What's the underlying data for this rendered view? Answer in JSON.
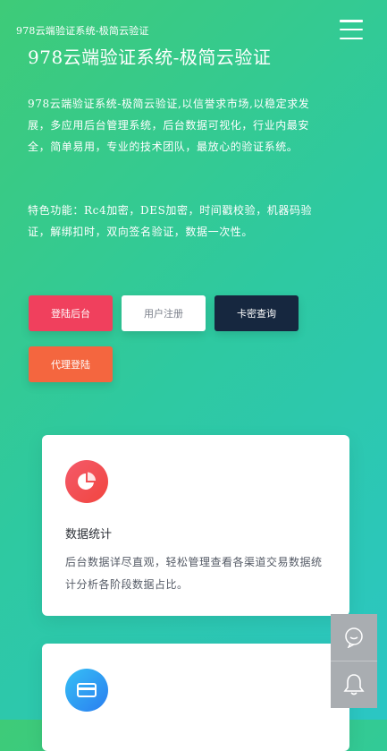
{
  "header": {
    "brand": "978云端验证系统-极简云验证",
    "menu_icon": "hamburger-menu-icon"
  },
  "hero": {
    "title": "978云端验证系统-极简云验证",
    "description": "978云端验证系统-极简云验证,以信誉求市场,以稳定求发展，多应用后台管理系统，后台数据可视化，行业内最安全，简单易用，专业的技术团队，最放心的验证系统。",
    "features": "特色功能：Rc4加密，DES加密，时间戳校验，机器码验证，解绑扣时，双向签名验证，数据一次性。"
  },
  "buttons": {
    "login": "登陆后台",
    "register": "用户注册",
    "card_query": "卡密查询",
    "agent_login": "代理登陆"
  },
  "cards": [
    {
      "icon": "pie-chart-icon",
      "title": "数据统计",
      "text": "后台数据详尽直观，轻松管理查看各渠道交易数据统计分析各阶段数据占比。"
    },
    {
      "icon": "credit-card-icon"
    }
  ],
  "floating": {
    "chat_icon": "chat-bubble-icon",
    "bell_icon": "bell-icon"
  },
  "colors": {
    "login": "#f0405d",
    "register": "#ffffff",
    "card_query": "#16273f",
    "agent_login": "#f4663f"
  }
}
